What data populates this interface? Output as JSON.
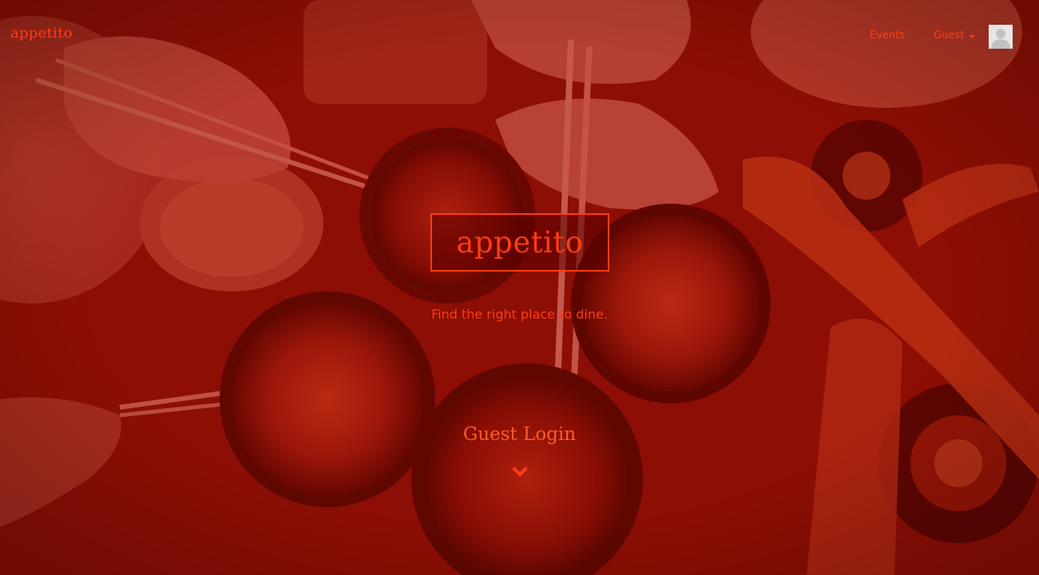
{
  "nav": {
    "brand": "appetito",
    "events_label": "Events",
    "guest_label": "Guest"
  },
  "hero": {
    "logo_text": "appetito",
    "tagline": "Find the right place to dine.",
    "guest_login_label": "Guest Login"
  },
  "icons": {
    "user_menu": "caret-down-icon",
    "avatar": "default-user-avatar-icon",
    "scroll_down": "chevron-down-icon"
  },
  "colors": {
    "accent": "#ff3c14",
    "overlay": "#8a0c06"
  }
}
